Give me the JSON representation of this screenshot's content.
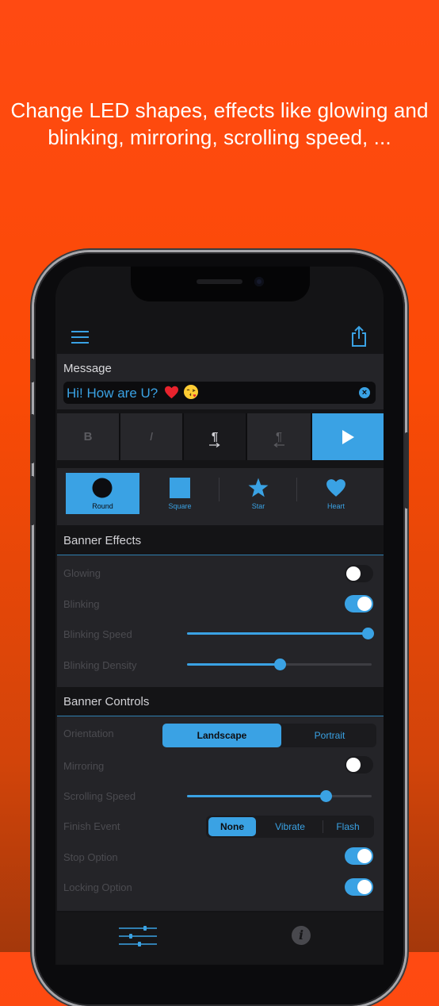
{
  "promo": {
    "line1": "Change LED shapes, effects like glowing and",
    "line2": "blinking, mirroring, scrolling speed, ..."
  },
  "colors": {
    "background": "#ff4a12",
    "accent": "#3aa2e4",
    "panel": "#242428"
  },
  "toolbar": {
    "menu_icon": "hamburger-icon",
    "share_icon": "share-icon"
  },
  "message": {
    "label": "Message",
    "value": "Hi! How are U?",
    "emoji": [
      "red-heart",
      "face-blowing-kiss"
    ],
    "clear_glyph": "×"
  },
  "format_buttons": {
    "bold": "B",
    "italic": "I",
    "ltr": "¶",
    "rtl": "¶",
    "play_icon": "play-icon"
  },
  "shapes": {
    "selected": "Round",
    "items": [
      {
        "label": "Round",
        "icon": "circle"
      },
      {
        "label": "Square",
        "icon": "square"
      },
      {
        "label": "Star",
        "icon": "star"
      },
      {
        "label": "Heart",
        "icon": "heart"
      }
    ]
  },
  "banner_effects": {
    "title": "Banner Effects",
    "glowing": {
      "label": "Glowing",
      "on": false
    },
    "blinking": {
      "label": "Blinking",
      "on": true
    },
    "blinking_speed": {
      "label": "Blinking Speed",
      "value": 1.0
    },
    "blinking_density": {
      "label": "Blinking Density",
      "value": 0.5
    }
  },
  "banner_controls": {
    "title": "Banner Controls",
    "orientation": {
      "label": "Orientation",
      "options": [
        "Landscape",
        "Portrait"
      ],
      "selected": "Landscape"
    },
    "mirroring": {
      "label": "Mirroring",
      "on": false
    },
    "scrolling_speed": {
      "label": "Scrolling Speed",
      "value": 0.75
    },
    "finish_event": {
      "label": "Finish Event",
      "options": [
        "None",
        "Vibrate",
        "Flash"
      ],
      "selected": "None"
    },
    "stop_option": {
      "label": "Stop Option",
      "on": true
    },
    "locking_option": {
      "label": "Locking Option",
      "on": true
    }
  },
  "tabbar": {
    "tab1_icon": "sliders-icon",
    "tab2_icon": "info-icon",
    "tab2_glyph": "i"
  }
}
